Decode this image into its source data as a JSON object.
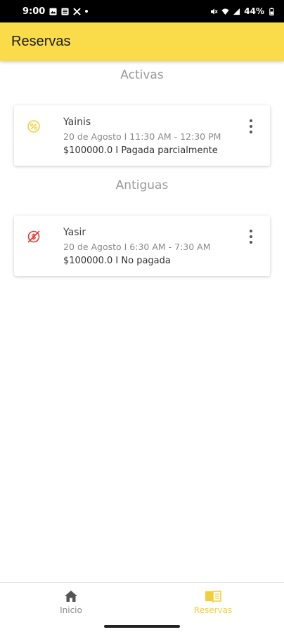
{
  "status_bar": {
    "time": "9:00",
    "battery": "44%",
    "left_icons": [
      "gallery-icon",
      "news-icon",
      "x-icon",
      "dot-icon"
    ],
    "right_icons": [
      "mute-icon",
      "wifi-icon",
      "signal-icon",
      "battery-icon"
    ]
  },
  "app_bar": {
    "title": "Reservas",
    "color": "#fadc4a"
  },
  "sections": [
    {
      "title": "Activas",
      "cards": [
        {
          "icon": "partial-payment-icon",
          "icon_color": "#f2cf3a",
          "name": "Yainis",
          "date": "20 de Agosto I 11:30 AM - 12:30 PM",
          "status": "$100000.0 I Pagada parcialmente"
        }
      ]
    },
    {
      "title": "Antiguas",
      "cards": [
        {
          "icon": "not-paid-icon",
          "icon_color": "#e53935",
          "name": "Yasir",
          "date": "20 de Agosto I 6:30 AM - 7:30 AM",
          "status": "$100000.0 I No pagada"
        }
      ]
    }
  ],
  "bottom_nav": {
    "items": [
      {
        "label": "Inicio",
        "icon": "home-icon",
        "active": false
      },
      {
        "label": "Reservas",
        "icon": "reservations-book-icon",
        "active": true
      }
    ],
    "active_color": "#f2cf3a"
  }
}
